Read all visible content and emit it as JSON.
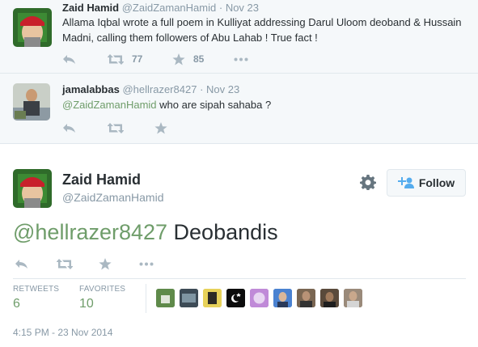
{
  "tweets_context": [
    {
      "fullname": "Zaid Hamid",
      "handle": "@ZaidZamanHamid",
      "time": "Nov 23",
      "text": "Allama Iqbal wrote a full poem in Kulliyat addressing Darul Uloom deoband & Hussain Madni, calling them followers of Abu Lahab ! True fact !",
      "retweets": "77",
      "favorites": "85"
    },
    {
      "fullname": "jamalabbas",
      "handle": "@hellrazer8427",
      "time": "Nov 23",
      "mention": "@ZaidZamanHamid",
      "text": " who are sipah sahaba ?"
    }
  ],
  "main_tweet": {
    "fullname": "Zaid Hamid",
    "handle": "@ZaidZamanHamid",
    "follow_label": "Follow",
    "mention": "@hellrazer8427",
    "text": " Deobandis",
    "retweets_label": "RETWEETS",
    "retweets": "6",
    "favorites_label": "FAVORITES",
    "favorites": "10",
    "timestamp": "4:15 PM - 23 Nov 2014"
  },
  "icons": [
    "reply-icon",
    "retweet-icon",
    "favorite-icon",
    "more-icon",
    "gear-icon",
    "follow-person-icon"
  ],
  "colors": {
    "accent_green": "#6f9d6a",
    "muted": "#8899a6",
    "icon_gray": "#aab8c2",
    "bg_context": "#f5f8fa"
  }
}
